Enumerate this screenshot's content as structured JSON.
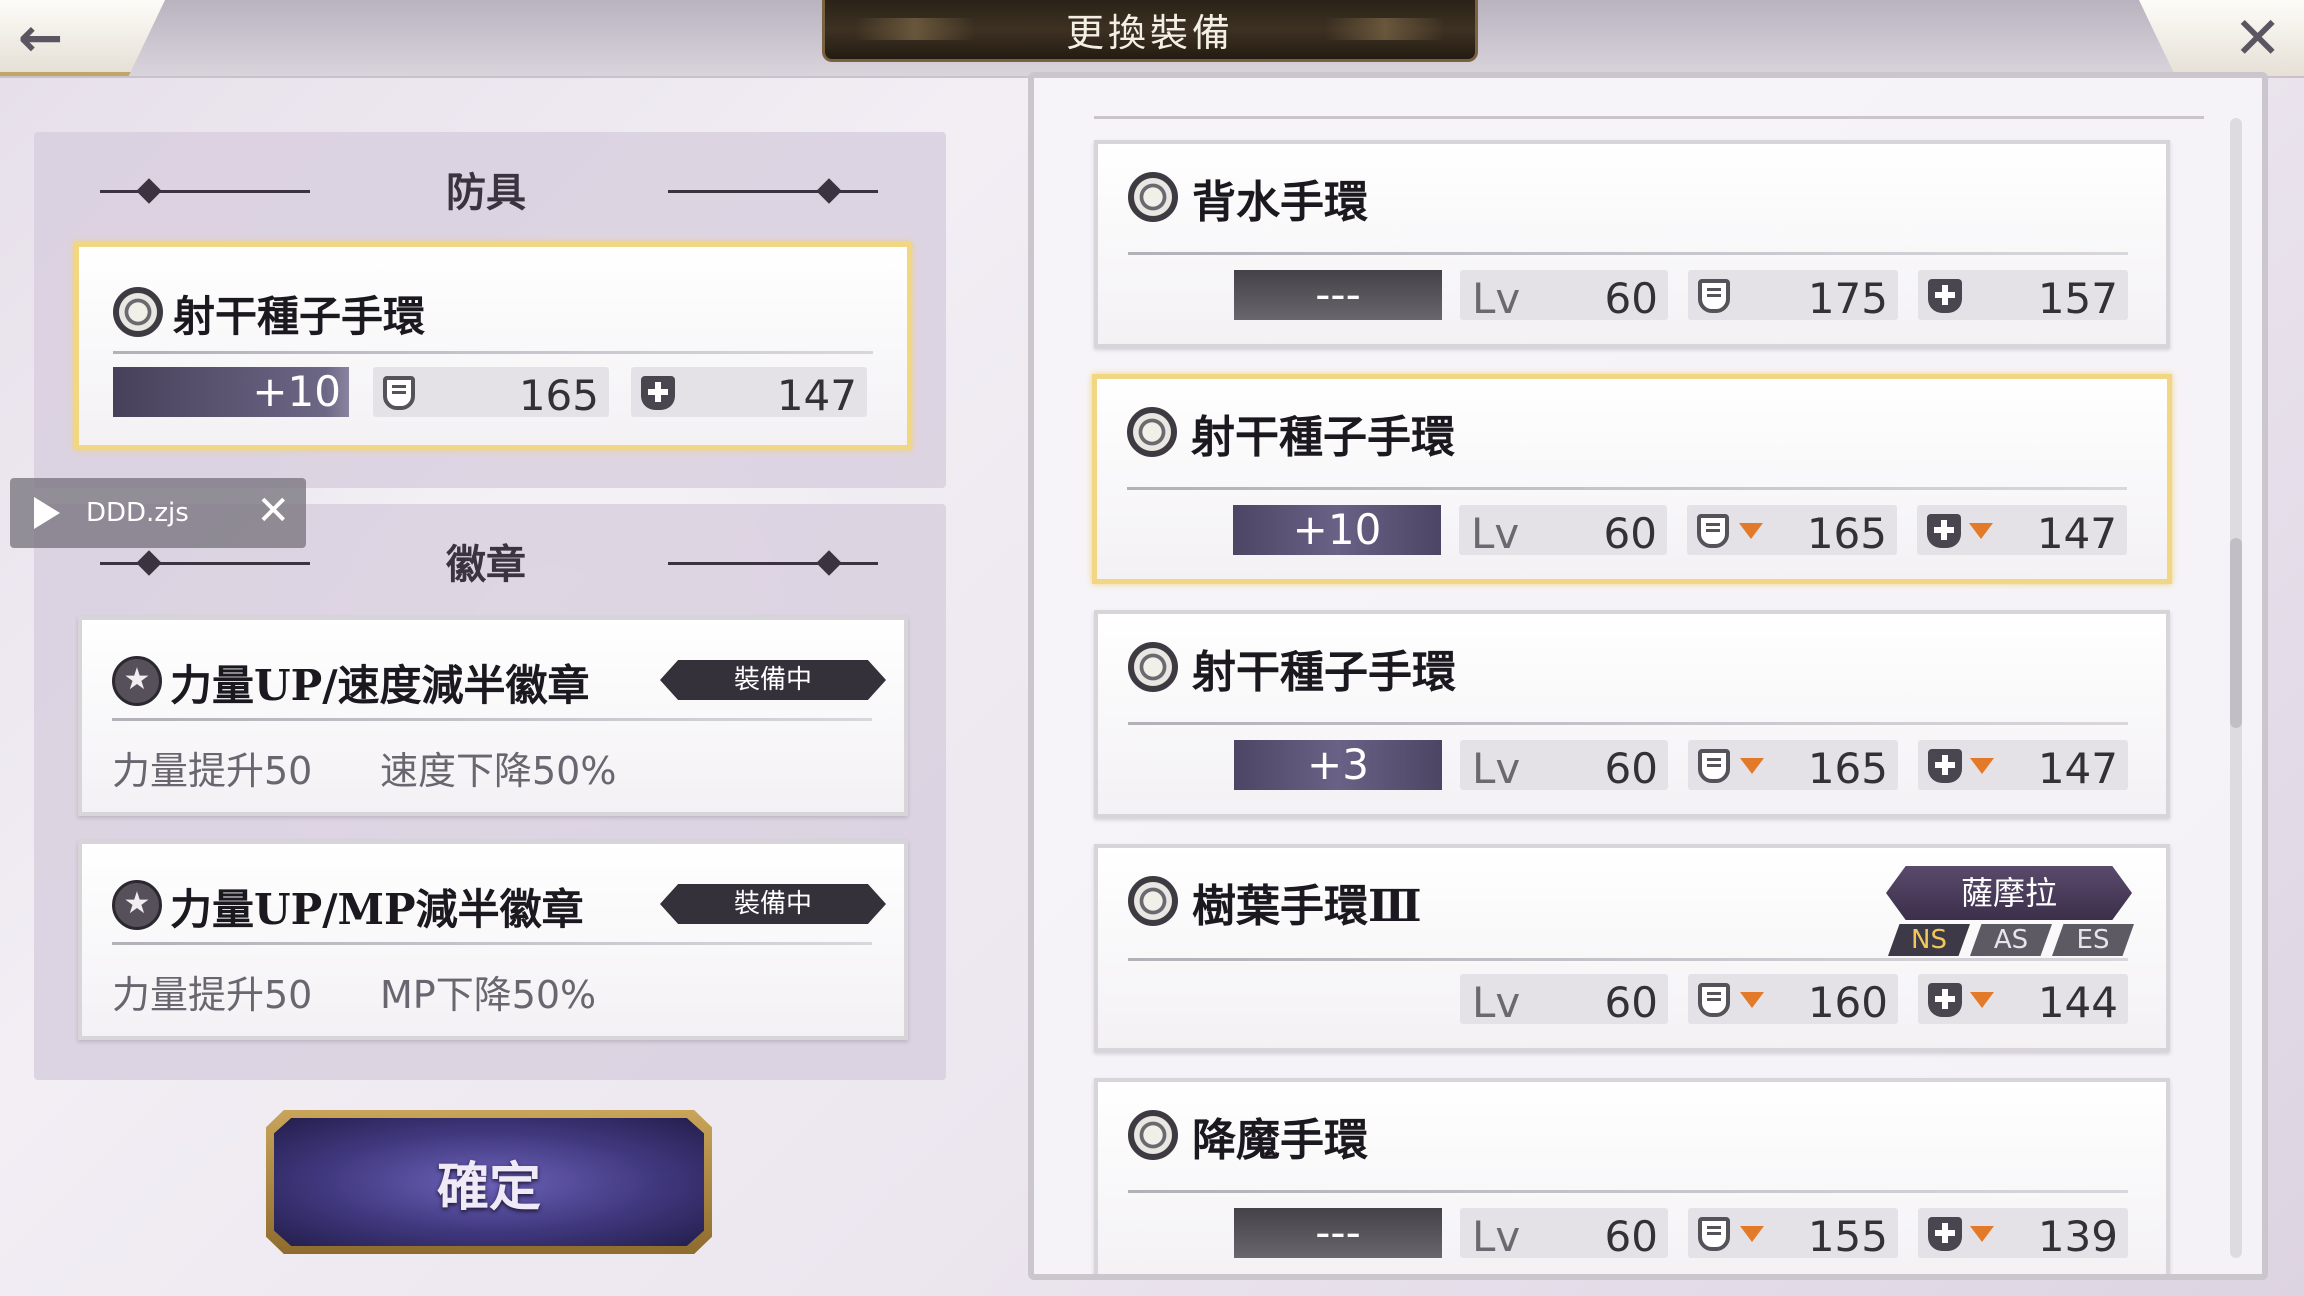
{
  "header": {
    "title": "更換裝備"
  },
  "left": {
    "armor_section_title": "防具",
    "armor_card": {
      "name": "射干種子手環",
      "refine": "+10",
      "def": "165",
      "mdef": "147"
    },
    "badge_section_title": "徽章",
    "badges": [
      {
        "name": "力量UP/速度減半徽章",
        "tag": "裝備中",
        "desc1": "力量提升50",
        "desc2": "速度下降50%"
      },
      {
        "name": "力量UP/MP減半徽章",
        "tag": "裝備中",
        "desc1": "力量提升50",
        "desc2": "MP下降50%"
      }
    ],
    "confirm_label": "確定"
  },
  "video_overlay": {
    "filename": "DDD.zjs"
  },
  "list": {
    "items": [
      {
        "name": "背水手環",
        "refine": "---",
        "lv_label": "Lv",
        "lv": "60",
        "def": "175",
        "mdef": "157",
        "down": false
      },
      {
        "name": "射干種子手環",
        "refine": "+10",
        "lv_label": "Lv",
        "lv": "60",
        "def": "165",
        "mdef": "147",
        "down": true
      },
      {
        "name": "射干種子手環",
        "refine": "+3",
        "lv_label": "Lv",
        "lv": "60",
        "def": "165",
        "mdef": "147",
        "down": true
      },
      {
        "name": "樹葉手環Ⅲ",
        "refine": "",
        "lv_label": "Lv",
        "lv": "60",
        "def": "160",
        "mdef": "144",
        "down": true,
        "char": "薩摩拉",
        "styles": [
          "NS",
          "AS",
          "ES"
        ]
      },
      {
        "name": "降魔手環",
        "refine": "---",
        "lv_label": "Lv",
        "lv": "60",
        "def": "155",
        "mdef": "139",
        "down": true
      }
    ]
  },
  "colors": {
    "selected_border": "#f1d684",
    "down_arrow": "#e37a2a",
    "confirm_button": "#40387e"
  }
}
